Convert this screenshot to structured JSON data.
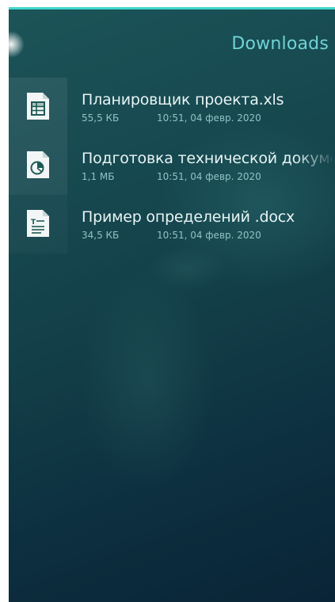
{
  "header": {
    "title": "Downloads"
  },
  "colors": {
    "accent": "#41d6cf",
    "title": "#6fd3d6",
    "background_top": "#1c5458",
    "background_bottom": "#092436"
  },
  "files": [
    {
      "name": "Планировщик проекта.xls",
      "size": "55,5 КБ",
      "date": "10:51, 04 февр. 2020",
      "icon": "spreadsheet-icon"
    },
    {
      "name": "Подготовка технической документации.pdf",
      "size": "1,1 МБ",
      "date": "10:51, 04 февр. 2020",
      "icon": "presentation-chart-icon"
    },
    {
      "name": "Пример определений .docx",
      "size": "34,5 КБ",
      "date": "10:51, 04 февр. 2020",
      "icon": "text-document-icon"
    }
  ]
}
